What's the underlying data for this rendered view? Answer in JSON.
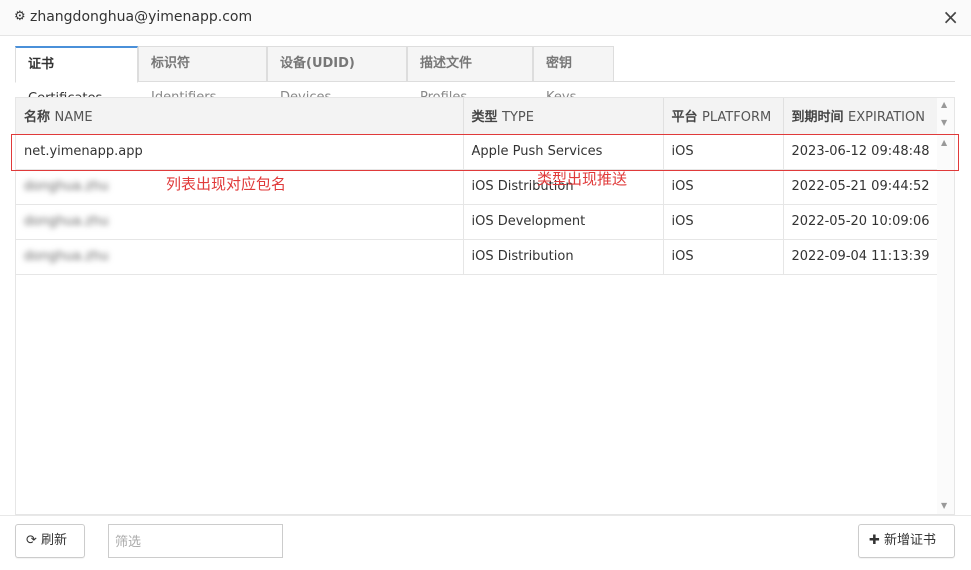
{
  "titlebar": {
    "gear_icon": "gear-icon",
    "account": "zhangdonghua@yimenapp.com",
    "close_icon": "×"
  },
  "tabs": [
    {
      "cn": "证书",
      "en": "Certificates",
      "active": true
    },
    {
      "cn": "标识符",
      "en": "Identifiers",
      "active": false
    },
    {
      "cn": "设备(UDID)",
      "en": "Devices",
      "active": false
    },
    {
      "cn": "描述文件",
      "en": "Profiles",
      "active": false
    },
    {
      "cn": "密钥",
      "en": "Keys",
      "active": false
    }
  ],
  "table": {
    "headers": [
      {
        "cn": "名称",
        "en": "NAME"
      },
      {
        "cn": "类型",
        "en": "TYPE"
      },
      {
        "cn": "平台",
        "en": "PLATFORM"
      },
      {
        "cn": "到期时间",
        "en": "EXPIRATION"
      }
    ],
    "rows": [
      {
        "name": "net.yimenapp.app",
        "type": "Apple Push Services",
        "platform": "iOS",
        "expiration": "2023-06-12 09:48:48"
      },
      {
        "name": "donghua.zhu",
        "type": "iOS Distribution",
        "platform": "iOS",
        "expiration": "2022-05-21 09:44:52"
      },
      {
        "name": "donghua.zhu",
        "type": "iOS Development",
        "platform": "iOS",
        "expiration": "2022-05-20 10:09:06"
      },
      {
        "name": "donghua.zhu",
        "type": "iOS Distribution",
        "platform": "iOS",
        "expiration": "2022-09-04 11:13:39"
      }
    ]
  },
  "annotations": {
    "name_note": "列表出现对应包名",
    "type_note": "类型出现推送",
    "highlight_color": "#e03a3a"
  },
  "footer": {
    "refresh_label": "刷新",
    "refresh_icon": "refresh-icon",
    "filter_placeholder": "筛选",
    "add_label": "新增证书",
    "add_icon": "plus-icon"
  }
}
